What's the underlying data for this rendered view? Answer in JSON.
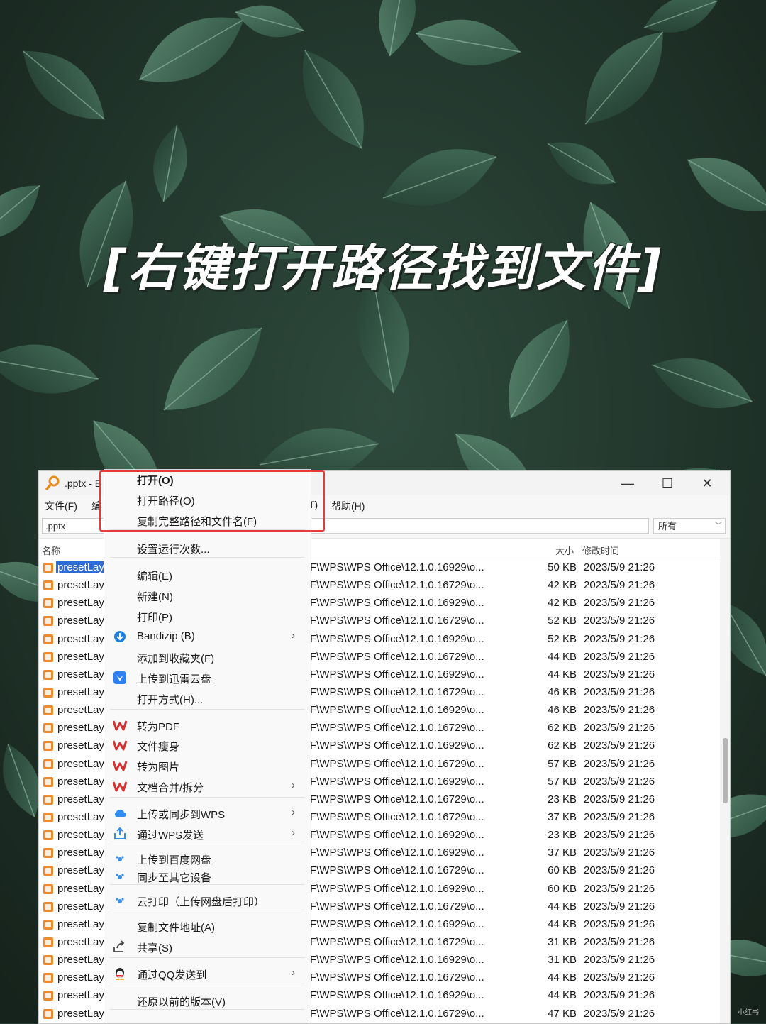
{
  "headline": "[右键打开路径找到文件]",
  "window": {
    "title": ".pptx - E",
    "menus": [
      "文件(F)",
      "编",
      "T)",
      "帮助(H)"
    ],
    "search_value": ".pptx",
    "filter_value": "所有",
    "columns": {
      "name": "名称",
      "size": "大小",
      "modified": "修改时间"
    }
  },
  "files": [
    {
      "name": "presetLay",
      "path": "F\\WPS\\WPS Office\\12.1.0.16929\\o...",
      "size": "50 KB",
      "date": "2023/5/9 21:26"
    },
    {
      "name": "presetLay",
      "path": "F\\WPS\\WPS Office\\12.1.0.16729\\o...",
      "size": "42 KB",
      "date": "2023/5/9 21:26"
    },
    {
      "name": "presetLay",
      "path": "F\\WPS\\WPS Office\\12.1.0.16929\\o...",
      "size": "42 KB",
      "date": "2023/5/9 21:26"
    },
    {
      "name": "presetLay",
      "path": "F\\WPS\\WPS Office\\12.1.0.16729\\o...",
      "size": "52 KB",
      "date": "2023/5/9 21:26"
    },
    {
      "name": "presetLay",
      "path": "F\\WPS\\WPS Office\\12.1.0.16929\\o...",
      "size": "52 KB",
      "date": "2023/5/9 21:26"
    },
    {
      "name": "presetLay",
      "path": "F\\WPS\\WPS Office\\12.1.0.16729\\o...",
      "size": "44 KB",
      "date": "2023/5/9 21:26"
    },
    {
      "name": "presetLay",
      "path": "F\\WPS\\WPS Office\\12.1.0.16929\\o...",
      "size": "44 KB",
      "date": "2023/5/9 21:26"
    },
    {
      "name": "presetLay",
      "path": "F\\WPS\\WPS Office\\12.1.0.16729\\o...",
      "size": "46 KB",
      "date": "2023/5/9 21:26"
    },
    {
      "name": "presetLay",
      "path": "F\\WPS\\WPS Office\\12.1.0.16929\\o...",
      "size": "46 KB",
      "date": "2023/5/9 21:26"
    },
    {
      "name": "presetLay",
      "path": "F\\WPS\\WPS Office\\12.1.0.16729\\o...",
      "size": "62 KB",
      "date": "2023/5/9 21:26"
    },
    {
      "name": "presetLay",
      "path": "F\\WPS\\WPS Office\\12.1.0.16929\\o...",
      "size": "62 KB",
      "date": "2023/5/9 21:26"
    },
    {
      "name": "presetLay",
      "path": "F\\WPS\\WPS Office\\12.1.0.16729\\o...",
      "size": "57 KB",
      "date": "2023/5/9 21:26"
    },
    {
      "name": "presetLay",
      "path": "F\\WPS\\WPS Office\\12.1.0.16929\\o...",
      "size": "57 KB",
      "date": "2023/5/9 21:26"
    },
    {
      "name": "presetLay",
      "path": "F\\WPS\\WPS Office\\12.1.0.16729\\o...",
      "size": "23 KB",
      "date": "2023/5/9 21:26"
    },
    {
      "name": "presetLay",
      "path": "F\\WPS\\WPS Office\\12.1.0.16729\\o...",
      "size": "37 KB",
      "date": "2023/5/9 21:26"
    },
    {
      "name": "presetLay",
      "path": "F\\WPS\\WPS Office\\12.1.0.16929\\o...",
      "size": "23 KB",
      "date": "2023/5/9 21:26"
    },
    {
      "name": "presetLay",
      "path": "F\\WPS\\WPS Office\\12.1.0.16929\\o...",
      "size": "37 KB",
      "date": "2023/5/9 21:26"
    },
    {
      "name": "presetLay",
      "path": "F\\WPS\\WPS Office\\12.1.0.16729\\o...",
      "size": "60 KB",
      "date": "2023/5/9 21:26"
    },
    {
      "name": "presetLay",
      "path": "F\\WPS\\WPS Office\\12.1.0.16929\\o...",
      "size": "60 KB",
      "date": "2023/5/9 21:26"
    },
    {
      "name": "presetLay",
      "path": "F\\WPS\\WPS Office\\12.1.0.16729\\o...",
      "size": "44 KB",
      "date": "2023/5/9 21:26"
    },
    {
      "name": "presetLay",
      "path": "F\\WPS\\WPS Office\\12.1.0.16929\\o...",
      "size": "44 KB",
      "date": "2023/5/9 21:26"
    },
    {
      "name": "presetLay",
      "path": "F\\WPS\\WPS Office\\12.1.0.16729\\o...",
      "size": "31 KB",
      "date": "2023/5/9 21:26"
    },
    {
      "name": "presetLay",
      "path": "F\\WPS\\WPS Office\\12.1.0.16929\\o...",
      "size": "31 KB",
      "date": "2023/5/9 21:26"
    },
    {
      "name": "presetLay",
      "path": "F\\WPS\\WPS Office\\12.1.0.16729\\o...",
      "size": "44 KB",
      "date": "2023/5/9 21:26"
    },
    {
      "name": "presetLay",
      "path": "F\\WPS\\WPS Office\\12.1.0.16929\\o...",
      "size": "44 KB",
      "date": "2023/5/9 21:26"
    },
    {
      "name": "presetLay",
      "path": "F\\WPS\\WPS Office\\12.1.0.16729\\o...",
      "size": "47 KB",
      "date": "2023/5/9 21:26"
    }
  ],
  "context_menu": {
    "items": [
      {
        "label": "打开(O)",
        "icon": "",
        "bold": true
      },
      {
        "label": "打开路径(O)",
        "icon": ""
      },
      {
        "label": "复制完整路径和文件名(F)",
        "icon": ""
      },
      {
        "label": "设置运行次数...",
        "icon": ""
      },
      {
        "label": "编辑(E)",
        "icon": ""
      },
      {
        "label": "新建(N)",
        "icon": ""
      },
      {
        "label": "打印(P)",
        "icon": ""
      },
      {
        "label": "Bandizip (B)",
        "icon": "bandizip-icon",
        "submenu": true
      },
      {
        "label": "添加到收藏夹(F)",
        "icon": ""
      },
      {
        "label": "上传到迅雷云盘",
        "icon": "xunlei-icon"
      },
      {
        "label": "打开方式(H)...",
        "icon": ""
      },
      {
        "label": "转为PDF",
        "icon": "wps-icon"
      },
      {
        "label": "文件瘦身",
        "icon": "wps-icon"
      },
      {
        "label": "转为图片",
        "icon": "wps-icon"
      },
      {
        "label": "文档合并/拆分",
        "icon": "wps-icon",
        "submenu": true
      },
      {
        "label": "上传或同步到WPS",
        "icon": "cloud-icon",
        "submenu": true
      },
      {
        "label": "通过WPS发送",
        "icon": "share-out-icon",
        "submenu": true
      },
      {
        "label": "上传到百度网盘",
        "icon": "baidu-icon"
      },
      {
        "label": "同步至其它设备",
        "icon": "baidu-icon"
      },
      {
        "label": "云打印（上传网盘后打印）",
        "icon": "baidu-icon"
      },
      {
        "label": "复制文件地址(A)",
        "icon": ""
      },
      {
        "label": "共享(S)",
        "icon": "share-icon"
      },
      {
        "label": "通过QQ发送到",
        "icon": "qq-icon",
        "submenu": true
      },
      {
        "label": "还原以前的版本(V)",
        "icon": ""
      }
    ]
  },
  "colors": {
    "highlight_box": "#e33a3a",
    "selection": "#2e6bd6",
    "wps_red": "#d9302f"
  },
  "watermark": "小红书"
}
